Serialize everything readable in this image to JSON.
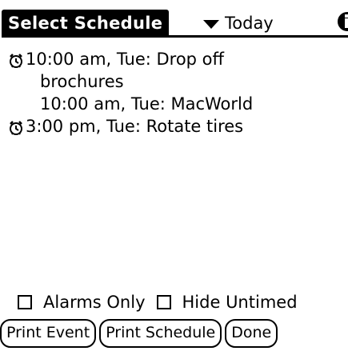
{
  "header": {
    "title": "Select Schedule",
    "range_selected": "Today"
  },
  "events": [
    {
      "time": "10:00 am, Tue: Drop off",
      "continued": "brochures",
      "alarm": true
    },
    {
      "time": "10:00 am, Tue: MacWorld",
      "continued": "",
      "alarm": false
    },
    {
      "time": "3:00 pm, Tue: Rotate tires",
      "continued": "",
      "alarm": true
    }
  ],
  "filters": {
    "alarms_only_label": "Alarms Only",
    "hide_untimed_label": "Hide Untimed",
    "alarms_only_checked": false,
    "hide_untimed_checked": false
  },
  "buttons": {
    "print_event": "Print Event",
    "print_schedule": "Print Schedule",
    "done": "Done"
  },
  "colors": {
    "foreground": "#000000",
    "background": "#ffffff"
  }
}
